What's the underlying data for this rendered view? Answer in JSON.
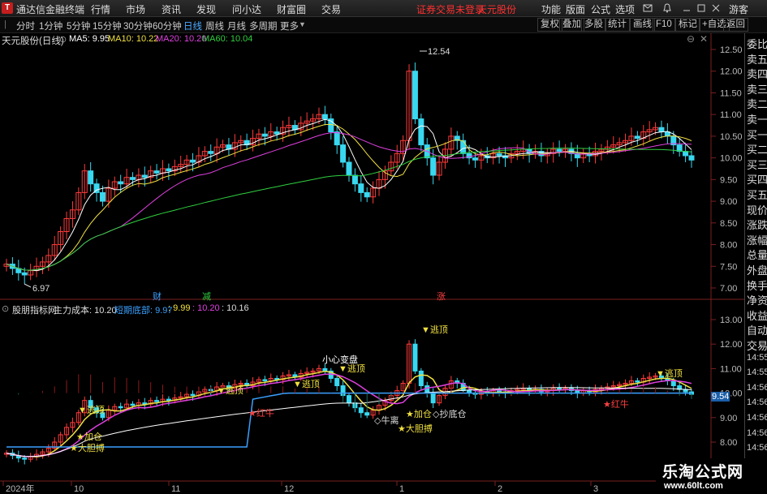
{
  "titlebar": {
    "app_title": "通达信金融终端",
    "menu": [
      "行情",
      "市场",
      "资讯",
      "发现",
      "问小达",
      "财富圈",
      "交易"
    ],
    "notice": "证券交易未登录",
    "stock_name": "天元股份",
    "right_menu": [
      "功能",
      "版面",
      "公式",
      "选项"
    ],
    "guest": "游客"
  },
  "periods": {
    "items": [
      "分时",
      "1分钟",
      "5分钟",
      "15分钟",
      "30分钟",
      "60分钟",
      "日线",
      "周线",
      "月线",
      "多周期",
      "更多"
    ],
    "active": "日线"
  },
  "tools": [
    "复权",
    "叠加",
    "多股",
    "统计",
    "画线",
    "F10",
    "标记",
    "+自选",
    "返回"
  ],
  "main_panel": {
    "title": "天元股份(日线)",
    "ma": [
      {
        "label": "MA5: 9.95",
        "color": "#ffffff"
      },
      {
        "label": "MA10: 10.22",
        "color": "#f0e040"
      },
      {
        "label": "MA20: 10.20",
        "color": "#e040e0"
      },
      {
        "label": "MA60: 10.04",
        "color": "#30d040"
      }
    ],
    "high_label": "12.54",
    "low_label": "6.97",
    "markers": [
      {
        "text": "财",
        "color": "#3aa0ff"
      },
      {
        "text": "减",
        "color": "#30d040"
      },
      {
        "text": "涨",
        "color": "#ff4040"
      }
    ],
    "y_ticks": [
      "12.50",
      "12.00",
      "11.50",
      "11.00",
      "10.50",
      "10.00",
      "9.50",
      "9.00",
      "8.50",
      "8.00",
      "7.50",
      "7.00"
    ]
  },
  "sub_panel": {
    "title": "股朋指标网",
    "line1_label": "主力成本: 10.20",
    "line2_label": "短期底部: 9.97",
    "v1": ": 9.99",
    "v2": ": 10.20",
    "v3": ": 10.16",
    "current_value": "9.54",
    "y_ticks": [
      "13.00",
      "12.00",
      "11.00",
      "10.00",
      "9.00",
      "8.00"
    ],
    "annotations": [
      "小心变盘",
      "逃顶",
      "逃顶",
      "逃顶",
      "逃顶",
      "逃顶",
      "逃顶",
      "加仓",
      "大胆搏",
      "红牛",
      "牛离",
      "加仓",
      "大胆搏",
      "抄底仓",
      "红牛"
    ]
  },
  "x_axis": [
    "2024年",
    "10",
    "11",
    "12",
    "1",
    "2",
    "3"
  ],
  "right_labels": [
    "委比",
    "卖五",
    "卖四",
    "卖三",
    "卖二",
    "卖一",
    "买一",
    "买二",
    "买三",
    "买四",
    "买五",
    "现价",
    "涨跌",
    "涨幅",
    "总量",
    "外盘",
    "换手",
    "净资",
    "收益",
    "自动",
    "交易",
    "14:55",
    "14:55",
    "14:56",
    "14:56",
    "14:56",
    "14:56",
    "14:56",
    "14:56",
    "14:56"
  ],
  "watermark": {
    "line1": "乐淘公式网",
    "line2": "www.60lt.com"
  },
  "colors": {
    "up": "#ff3b3b",
    "down": "#38d8f0",
    "ma5": "#ffffff",
    "ma10": "#f0e040",
    "ma20": "#e040e0",
    "ma60": "#30d040",
    "cost": "#3aa0ff"
  },
  "chart_data": {
    "type": "candlestick",
    "price_range": [
      6.7,
      12.9
    ],
    "closes": [
      7.55,
      7.45,
      7.35,
      7.3,
      7.4,
      7.5,
      7.6,
      7.75,
      8.0,
      8.3,
      8.6,
      8.8,
      9.2,
      9.7,
      9.4,
      9.2,
      9.0,
      9.3,
      9.45,
      9.4,
      9.55,
      9.5,
      9.6,
      9.55,
      9.7,
      9.65,
      9.75,
      9.7,
      9.8,
      9.85,
      9.95,
      9.9,
      10.05,
      10.15,
      10.1,
      10.25,
      10.3,
      10.2,
      10.35,
      10.4,
      10.3,
      10.45,
      10.55,
      10.5,
      10.6,
      10.55,
      10.7,
      10.75,
      10.65,
      10.8,
      10.85,
      10.9,
      11.0,
      10.9,
      10.6,
      10.3,
      9.9,
      9.6,
      9.4,
      9.2,
      9.1,
      9.3,
      9.5,
      9.7,
      9.9,
      10.1,
      10.4,
      12.0,
      10.9,
      10.3,
      10.0,
      9.6,
      9.9,
      10.2,
      10.5,
      10.4,
      10.1,
      10.0,
      9.95,
      10.05,
      10.0,
      10.1,
      10.05,
      10.0,
      10.1,
      10.15,
      10.2,
      10.1,
      10.15,
      10.05,
      10.1,
      10.2,
      10.15,
      10.2,
      10.1,
      10.0,
      10.1,
      10.05,
      10.15,
      10.2,
      10.25,
      10.3,
      10.35,
      10.4,
      10.5,
      10.45,
      10.6,
      10.65,
      10.7,
      10.6,
      10.5,
      10.3,
      10.15,
      10.05,
      9.95
    ],
    "high": 12.54,
    "low": 6.97
  }
}
